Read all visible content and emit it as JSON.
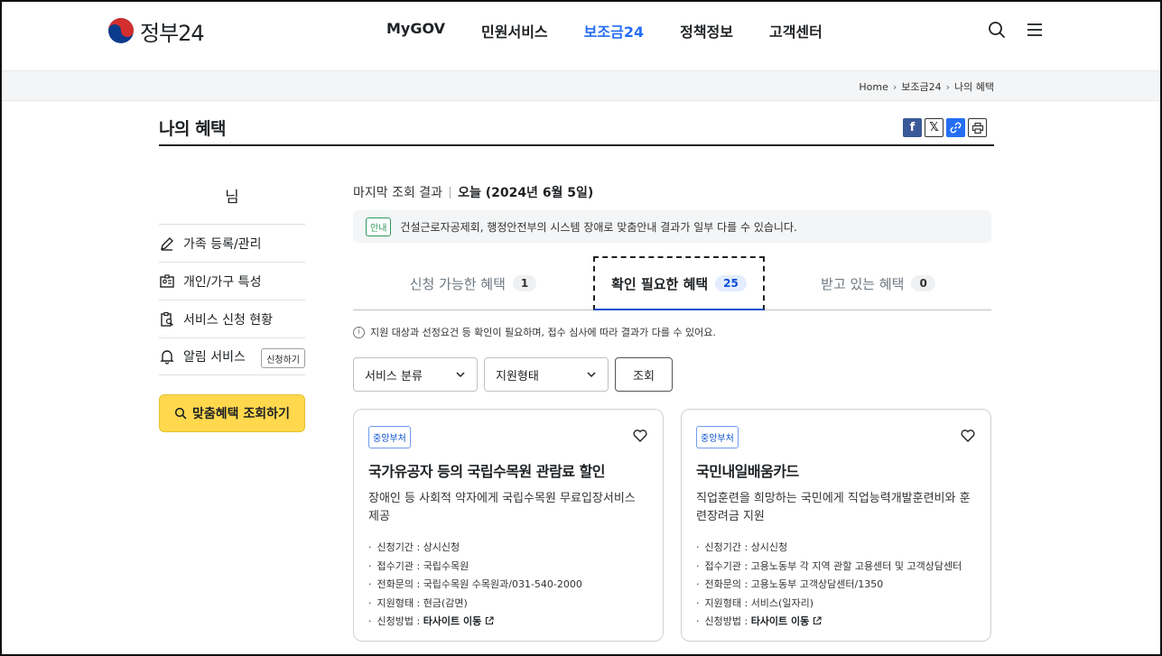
{
  "header": {
    "logo_text": "정부24",
    "nav": [
      "MyGOV",
      "민원서비스",
      "보조금24",
      "정책정보",
      "고객센터"
    ],
    "nav_active": 2,
    "icons": [
      "search-icon",
      "menu-icon"
    ]
  },
  "breadcrumb": [
    "Home",
    "보조금24",
    "나의 혜택"
  ],
  "page": {
    "title": "나의 혜택",
    "share": [
      "facebook-icon",
      "x-icon",
      "link-icon",
      "print-icon"
    ]
  },
  "sidebar": {
    "user_name": "님",
    "items": [
      {
        "label": "가족 등록/관리",
        "icon": "edit-icon"
      },
      {
        "label": "개인/가구 특성",
        "icon": "id-card-icon"
      },
      {
        "label": "서비스 신청 현황",
        "icon": "clipboard-search-icon"
      },
      {
        "label": "알림 서비스",
        "icon": "bell-icon",
        "action": "신청하기"
      }
    ],
    "cta": "맞춤혜택 조회하기"
  },
  "main": {
    "last_view_label": "마지막 조회 결과",
    "last_view_value": "오늘 (2024년 6월 5일)",
    "notice_badge": "안내",
    "notice_text": "건설근로자공제회, 행정안전부의 시스템 장애로 맞춤안내 결과가 일부 다를 수 있습니다.",
    "tabs": [
      {
        "label": "신청 가능한 혜택",
        "count": "1"
      },
      {
        "label": "확인 필요한 혜택",
        "count": "25"
      },
      {
        "label": "받고 있는 혜택",
        "count": "0"
      }
    ],
    "active_tab": 1,
    "help_text": "지원 대상과 선정요건 등 확인이 필요하며, 접수 심사에 따라 결과가 다를 수 있어요.",
    "filters": {
      "category": "서비스 분류",
      "support_type": "지원형태",
      "search_button": "조회"
    },
    "cards": [
      {
        "badge": "중앙부처",
        "title": "국가유공자 등의 국립수목원 관람료 할인",
        "desc": "장애인 등 사회적 약자에게 국립수목원 무료입장서비스 제공",
        "rows": [
          {
            "label": "신청기간",
            "value": "상시신청"
          },
          {
            "label": "접수기관",
            "value": "국립수목원"
          },
          {
            "label": "전화문의",
            "value": "국립수목원 수목원과/031-540-2000"
          },
          {
            "label": "지원형태",
            "value": "현금(감면)"
          }
        ],
        "method_label": "신청방법",
        "method_value": "타사이트 이동"
      },
      {
        "badge": "중앙부처",
        "title": "국민내일배움카드",
        "desc": "직업훈련을 희망하는 국민에게 직업능력개발훈련비와 훈련장려금 지원",
        "rows": [
          {
            "label": "신청기간",
            "value": "상시신청"
          },
          {
            "label": "접수기관",
            "value": "고용노동부 각 지역 관할 고용센터 및 고객상담센터"
          },
          {
            "label": "전화문의",
            "value": "고용노동부 고객상담센터/1350"
          },
          {
            "label": "지원형태",
            "value": "서비스(일자리)"
          }
        ],
        "method_label": "신청방법",
        "method_value": "타사이트 이동"
      }
    ]
  }
}
